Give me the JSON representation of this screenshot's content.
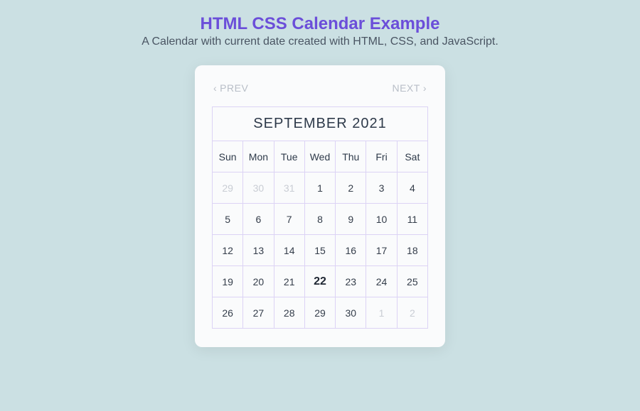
{
  "header": {
    "title": "HTML CSS Calendar Example",
    "subtitle": "A Calendar with current date created with HTML, CSS, and JavaScript."
  },
  "nav": {
    "prev": "PREV",
    "next": "NEXT"
  },
  "calendar": {
    "month_label": "SEPTEMBER 2021",
    "day_names": [
      "Sun",
      "Mon",
      "Tue",
      "Wed",
      "Thu",
      "Fri",
      "Sat"
    ],
    "weeks": [
      [
        {
          "n": "29",
          "muted": true
        },
        {
          "n": "30",
          "muted": true
        },
        {
          "n": "31",
          "muted": true
        },
        {
          "n": "1"
        },
        {
          "n": "2"
        },
        {
          "n": "3"
        },
        {
          "n": "4"
        }
      ],
      [
        {
          "n": "5"
        },
        {
          "n": "6"
        },
        {
          "n": "7"
        },
        {
          "n": "8"
        },
        {
          "n": "9"
        },
        {
          "n": "10"
        },
        {
          "n": "11"
        }
      ],
      [
        {
          "n": "12"
        },
        {
          "n": "13"
        },
        {
          "n": "14"
        },
        {
          "n": "15"
        },
        {
          "n": "16"
        },
        {
          "n": "17"
        },
        {
          "n": "18"
        }
      ],
      [
        {
          "n": "19"
        },
        {
          "n": "20"
        },
        {
          "n": "21"
        },
        {
          "n": "22",
          "today": true
        },
        {
          "n": "23"
        },
        {
          "n": "24"
        },
        {
          "n": "25"
        }
      ],
      [
        {
          "n": "26"
        },
        {
          "n": "27"
        },
        {
          "n": "28"
        },
        {
          "n": "29"
        },
        {
          "n": "30"
        },
        {
          "n": "1",
          "muted": true
        },
        {
          "n": "2",
          "muted": true
        }
      ]
    ]
  }
}
